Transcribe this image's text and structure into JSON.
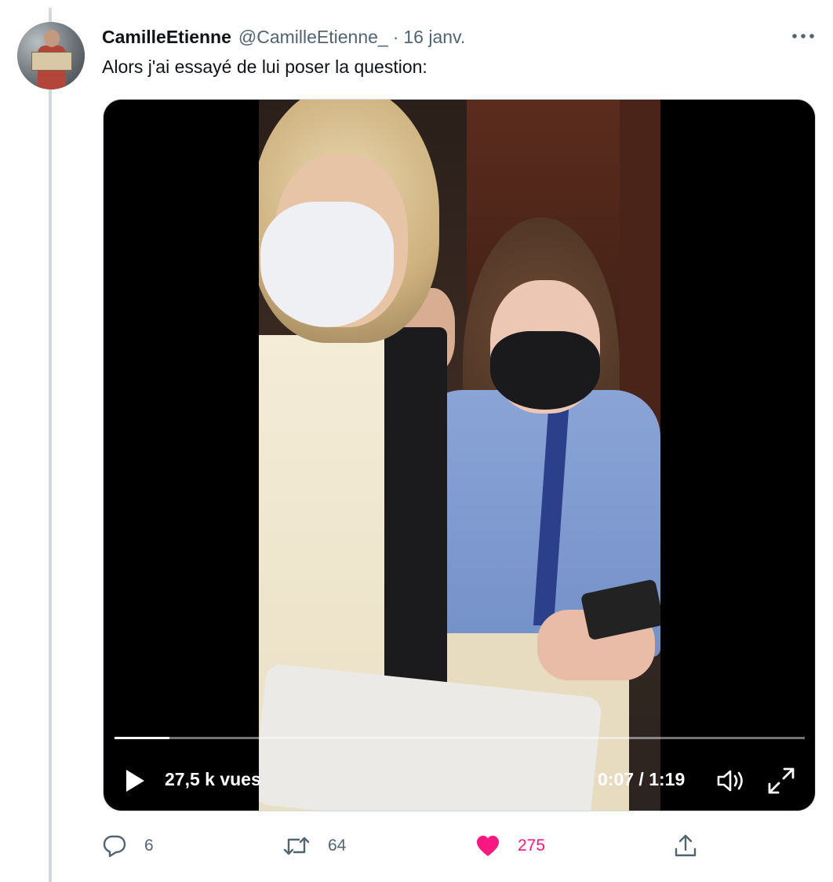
{
  "tweet": {
    "author_name": "CamilleEtienne",
    "author_handle": "@CamilleEtienne_",
    "separator": "·",
    "date": "16 janv.",
    "text": "Alors j'ai essayé de lui poser la question:"
  },
  "video": {
    "views": "27,5 k vues",
    "time": "0:07 / 1:19",
    "progress": 0.08
  },
  "actions": {
    "reply_count": "6",
    "retweet_count": "64",
    "like_count": "275"
  },
  "icons": {
    "more": "more-icon",
    "play": "play-icon",
    "volume": "volume-icon",
    "fullscreen": "fullscreen-icon",
    "reply": "reply-icon",
    "retweet": "retweet-icon",
    "like": "heart-icon",
    "share": "share-icon"
  },
  "colors": {
    "like_active": "#f91880",
    "secondary_text": "#536471",
    "thread_line": "#cfd9de"
  }
}
